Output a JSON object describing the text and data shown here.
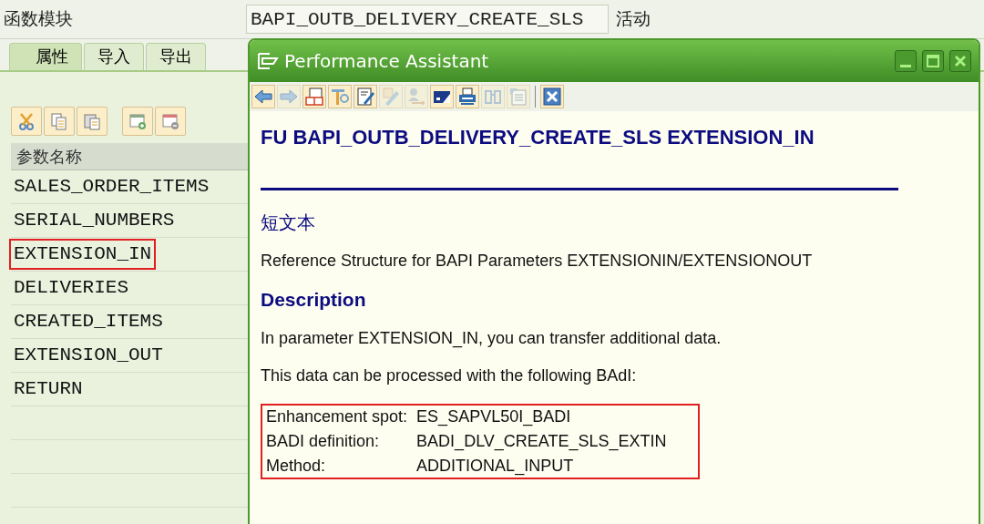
{
  "header": {
    "label": "函数模块",
    "value": "BAPI_OUTB_DELIVERY_CREATE_SLS",
    "status": "活动"
  },
  "tabs": [
    {
      "label": "属性",
      "selected": true
    },
    {
      "label": "导入",
      "selected": false
    },
    {
      "label": "导出",
      "selected": false
    }
  ],
  "parameter_table": {
    "column": "参数名称",
    "rows": [
      {
        "name": "SALES_ORDER_ITEMS",
        "highlighted": false
      },
      {
        "name": "SERIAL_NUMBERS",
        "highlighted": false
      },
      {
        "name": "EXTENSION_IN",
        "highlighted": true
      },
      {
        "name": "DELIVERIES",
        "highlighted": false
      },
      {
        "name": "CREATED_ITEMS",
        "highlighted": false
      },
      {
        "name": "EXTENSION_OUT",
        "highlighted": false
      },
      {
        "name": "RETURN",
        "highlighted": false
      }
    ]
  },
  "popup": {
    "title": "Performance Assistant",
    "toolbar": [
      {
        "disabled": false
      },
      {
        "disabled": true
      },
      {
        "disabled": false
      },
      {
        "disabled": false
      },
      {
        "disabled": false
      },
      {
        "disabled": true
      },
      {
        "disabled": true
      },
      {
        "disabled": false
      },
      {
        "disabled": false
      },
      {
        "disabled": true
      },
      {
        "disabled": true
      },
      {
        "disabled": false
      }
    ],
    "heading": "FU BAPI_OUTB_DELIVERY_CREATE_SLS EXTENSION_IN",
    "short_text_title": "短文本",
    "short_text": "Reference Structure for BAPI Parameters EXTENSIONIN/EXTENSIONOUT",
    "description_title": "Description",
    "paragraphs": [
      "In parameter EXTENSION_IN, you can transfer additional data.",
      "This data can be processed with the following BAdI:"
    ],
    "badi_info": {
      "highlighted": true,
      "rows": [
        {
          "label": "Enhancement spot:",
          "value": "ES_SAPVL50I_BADI"
        },
        {
          "label": "BADI definition:",
          "value": "BADI_DLV_CREATE_SLS_EXTIN"
        },
        {
          "label": "Method:",
          "value": "ADDITIONAL_INPUT"
        }
      ]
    }
  }
}
